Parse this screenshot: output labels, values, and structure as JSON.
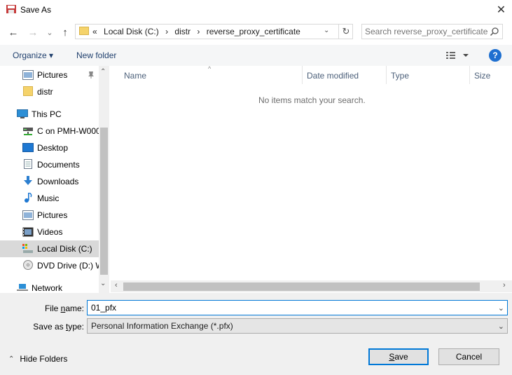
{
  "window": {
    "title": "Save As",
    "close_glyph": "✕"
  },
  "nav": {
    "back_glyph": "←",
    "forward_glyph": "→",
    "recent_glyph": "⌄",
    "up_glyph": "↑",
    "address": {
      "overflow": "«",
      "crumbs": [
        "Local Disk (C:)",
        "distr",
        "reverse_proxy_certificate"
      ],
      "separator": "›",
      "dropdown_glyph": "⌄",
      "refresh_glyph": "↻"
    },
    "search": {
      "placeholder": "Search reverse_proxy_certificate"
    }
  },
  "toolbar": {
    "organize_label": "Organize ▾",
    "new_folder_label": "New folder",
    "help_glyph": "?"
  },
  "sidebar": {
    "items": [
      {
        "label": "Pictures",
        "icon": "pictures-icon",
        "pinned": true
      },
      {
        "label": "distr",
        "icon": "folder-icon"
      },
      {
        "label": "This PC",
        "icon": "computer-icon"
      },
      {
        "label": "C on PMH-W000",
        "icon": "network-drive-icon"
      },
      {
        "label": "Desktop",
        "icon": "desktop-icon"
      },
      {
        "label": "Documents",
        "icon": "documents-icon"
      },
      {
        "label": "Downloads",
        "icon": "downloads-icon"
      },
      {
        "label": "Music",
        "icon": "music-icon"
      },
      {
        "label": "Pictures",
        "icon": "pictures-icon"
      },
      {
        "label": "Videos",
        "icon": "videos-icon"
      },
      {
        "label": "Local Disk (C:)",
        "icon": "local-disk-icon",
        "selected": true
      },
      {
        "label": "DVD Drive (D:) W",
        "icon": "dvd-drive-icon"
      },
      {
        "label": "Network",
        "icon": "network-icon"
      }
    ],
    "scroll_up_glyph": "⌃",
    "scroll_down_glyph": "⌄"
  },
  "file_list": {
    "columns": [
      "Name",
      "Date modified",
      "Type",
      "Size"
    ],
    "sort_glyph": "^",
    "empty_message": "No items match your search."
  },
  "form": {
    "file_name_label_pre": "File ",
    "file_name_label_key": "n",
    "file_name_label_post": "ame:",
    "file_name_value": "01_pfx",
    "save_type_label_pre": "Save as ",
    "save_type_label_key": "t",
    "save_type_label_post": "ype:",
    "save_type_value": "Personal Information Exchange (*.pfx)"
  },
  "footer": {
    "hide_folders_label": "Hide Folders",
    "save_label_key": "S",
    "save_label_rest": "ave",
    "cancel_label": "Cancel"
  },
  "colors": {
    "accent": "#0078d7",
    "selected_bg": "#d9d9d9",
    "toolbar_bg": "#f5f6f7",
    "footer_bg": "#f0f0f0"
  }
}
